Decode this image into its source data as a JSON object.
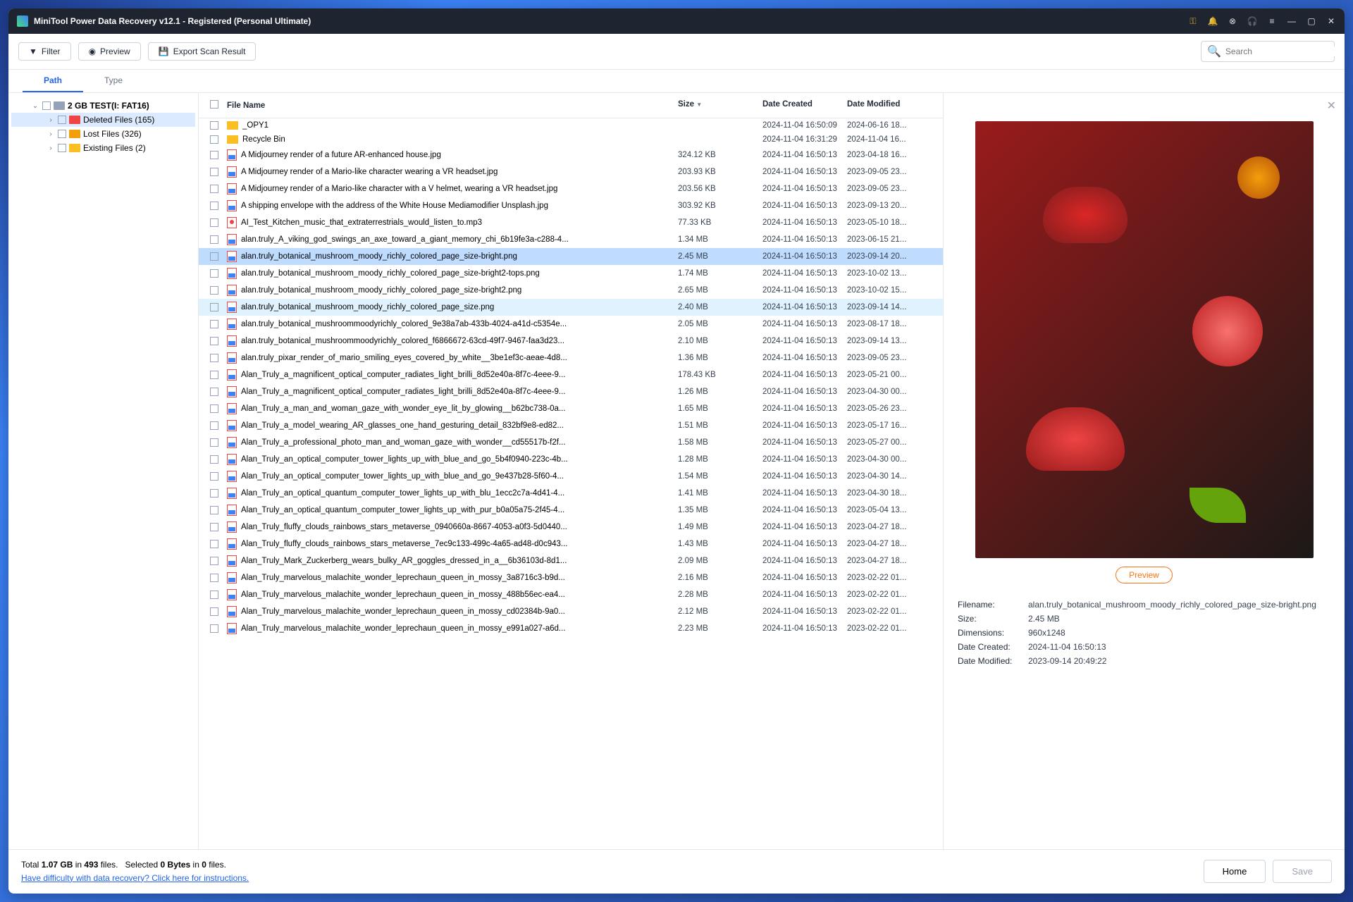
{
  "title": "MiniTool Power Data Recovery v12.1 - Registered (Personal Ultimate)",
  "toolbar": {
    "filter": "Filter",
    "preview": "Preview",
    "export": "Export Scan Result",
    "search_ph": "Search"
  },
  "tabs": {
    "path": "Path",
    "type": "Type"
  },
  "tree": {
    "root": "2 GB TEST(I: FAT16)",
    "deleted": "Deleted Files (165)",
    "lost": "Lost Files (326)",
    "existing": "Existing Files (2)"
  },
  "cols": {
    "name": "File Name",
    "size": "Size",
    "created": "Date Created",
    "modified": "Date Modified"
  },
  "files": [
    {
      "t": "folder",
      "n": "_OPY1",
      "s": "",
      "c": "2024-11-04 16:50:09",
      "m": "2024-06-16 18..."
    },
    {
      "t": "folder",
      "n": "Recycle Bin",
      "s": "",
      "c": "2024-11-04 16:31:29",
      "m": "2024-11-04 16..."
    },
    {
      "t": "img",
      "n": "A Midjourney render of a future AR-enhanced house.jpg",
      "s": "324.12 KB",
      "c": "2024-11-04 16:50:13",
      "m": "2023-04-18 16..."
    },
    {
      "t": "img",
      "n": "A Midjourney render of a Mario-like character wearing a VR headset.jpg",
      "s": "203.93 KB",
      "c": "2024-11-04 16:50:13",
      "m": "2023-09-05 23..."
    },
    {
      "t": "img",
      "n": "A Midjourney render of a Mario-like character with a V helmet, wearing a VR headset.jpg",
      "s": "203.56 KB",
      "c": "2024-11-04 16:50:13",
      "m": "2023-09-05 23..."
    },
    {
      "t": "img",
      "n": "A shipping envelope with the address of the White House Mediamodifier Unsplash.jpg",
      "s": "303.92 KB",
      "c": "2024-11-04 16:50:13",
      "m": "2023-09-13 20..."
    },
    {
      "t": "audio",
      "n": "AI_Test_Kitchen_music_that_extraterrestrials_would_listen_to.mp3",
      "s": "77.33 KB",
      "c": "2024-11-04 16:50:13",
      "m": "2023-05-10 18..."
    },
    {
      "t": "img",
      "n": "alan.truly_A_viking_god_swings_an_axe_toward_a_giant_memory_chi_6b19fe3a-c288-4...",
      "s": "1.34 MB",
      "c": "2024-11-04 16:50:13",
      "m": "2023-06-15 21..."
    },
    {
      "t": "img",
      "n": "alan.truly_botanical_mushroom_moody_richly_colored_page_size-bright.png",
      "s": "2.45 MB",
      "c": "2024-11-04 16:50:13",
      "m": "2023-09-14 20...",
      "sel": true
    },
    {
      "t": "img",
      "n": "alan.truly_botanical_mushroom_moody_richly_colored_page_size-bright2-tops.png",
      "s": "1.74 MB",
      "c": "2024-11-04 16:50:13",
      "m": "2023-10-02 13..."
    },
    {
      "t": "img",
      "n": "alan.truly_botanical_mushroom_moody_richly_colored_page_size-bright2.png",
      "s": "2.65 MB",
      "c": "2024-11-04 16:50:13",
      "m": "2023-10-02 15..."
    },
    {
      "t": "img",
      "n": "alan.truly_botanical_mushroom_moody_richly_colored_page_size.png",
      "s": "2.40 MB",
      "c": "2024-11-04 16:50:13",
      "m": "2023-09-14 14...",
      "hl": true
    },
    {
      "t": "img",
      "n": "alan.truly_botanical_mushroommoodyrichly_colored_9e38a7ab-433b-4024-a41d-c5354e...",
      "s": "2.05 MB",
      "c": "2024-11-04 16:50:13",
      "m": "2023-08-17 18..."
    },
    {
      "t": "img",
      "n": "alan.truly_botanical_mushroommoodyrichly_colored_f6866672-63cd-49f7-9467-faa3d23...",
      "s": "2.10 MB",
      "c": "2024-11-04 16:50:13",
      "m": "2023-09-14 13..."
    },
    {
      "t": "img",
      "n": "alan.truly_pixar_render_of_mario_smiling_eyes_covered_by_white__3be1ef3c-aeae-4d8...",
      "s": "1.36 MB",
      "c": "2024-11-04 16:50:13",
      "m": "2023-09-05 23..."
    },
    {
      "t": "img",
      "n": "Alan_Truly_a_magnificent_optical_computer_radiates_light_brilli_8d52e40a-8f7c-4eee-9...",
      "s": "178.43 KB",
      "c": "2024-11-04 16:50:13",
      "m": "2023-05-21 00..."
    },
    {
      "t": "img",
      "n": "Alan_Truly_a_magnificent_optical_computer_radiates_light_brilli_8d52e40a-8f7c-4eee-9...",
      "s": "1.26 MB",
      "c": "2024-11-04 16:50:13",
      "m": "2023-04-30 00..."
    },
    {
      "t": "img",
      "n": "Alan_Truly_a_man_and_woman_gaze_with_wonder_eye_lit_by_glowing__b62bc738-0a...",
      "s": "1.65 MB",
      "c": "2024-11-04 16:50:13",
      "m": "2023-05-26 23..."
    },
    {
      "t": "img",
      "n": "Alan_Truly_a_model_wearing_AR_glasses_one_hand_gesturing_detail_832bf9e8-ed82...",
      "s": "1.51 MB",
      "c": "2024-11-04 16:50:13",
      "m": "2023-05-17 16..."
    },
    {
      "t": "img",
      "n": "Alan_Truly_a_professional_photo_man_and_woman_gaze_with_wonder__cd55517b-f2f...",
      "s": "1.58 MB",
      "c": "2024-11-04 16:50:13",
      "m": "2023-05-27 00..."
    },
    {
      "t": "img",
      "n": "Alan_Truly_an_optical_computer_tower_lights_up_with_blue_and_go_5b4f0940-223c-4b...",
      "s": "1.28 MB",
      "c": "2024-11-04 16:50:13",
      "m": "2023-04-30 00..."
    },
    {
      "t": "img",
      "n": "Alan_Truly_an_optical_computer_tower_lights_up_with_blue_and_go_9e437b28-5f60-4...",
      "s": "1.54 MB",
      "c": "2024-11-04 16:50:13",
      "m": "2023-04-30 14..."
    },
    {
      "t": "img",
      "n": "Alan_Truly_an_optical_quantum_computer_tower_lights_up_with_blu_1ecc2c7a-4d41-4...",
      "s": "1.41 MB",
      "c": "2024-11-04 16:50:13",
      "m": "2023-04-30 18..."
    },
    {
      "t": "img",
      "n": "Alan_Truly_an_optical_quantum_computer_tower_lights_up_with_pur_b0a05a75-2f45-4...",
      "s": "1.35 MB",
      "c": "2024-11-04 16:50:13",
      "m": "2023-05-04 13..."
    },
    {
      "t": "img",
      "n": "Alan_Truly_fluffy_clouds_rainbows_stars_metaverse_0940660a-8667-4053-a0f3-5d0440...",
      "s": "1.49 MB",
      "c": "2024-11-04 16:50:13",
      "m": "2023-04-27 18..."
    },
    {
      "t": "img",
      "n": "Alan_Truly_fluffy_clouds_rainbows_stars_metaverse_7ec9c133-499c-4a65-ad48-d0c943...",
      "s": "1.43 MB",
      "c": "2024-11-04 16:50:13",
      "m": "2023-04-27 18..."
    },
    {
      "t": "img",
      "n": "Alan_Truly_Mark_Zuckerberg_wears_bulky_AR_goggles_dressed_in_a__6b36103d-8d1...",
      "s": "2.09 MB",
      "c": "2024-11-04 16:50:13",
      "m": "2023-04-27 18..."
    },
    {
      "t": "img",
      "n": "Alan_Truly_marvelous_malachite_wonder_leprechaun_queen_in_mossy_3a8716c3-b9d...",
      "s": "2.16 MB",
      "c": "2024-11-04 16:50:13",
      "m": "2023-02-22 01..."
    },
    {
      "t": "img",
      "n": "Alan_Truly_marvelous_malachite_wonder_leprechaun_queen_in_mossy_488b56ec-ea4...",
      "s": "2.28 MB",
      "c": "2024-11-04 16:50:13",
      "m": "2023-02-22 01..."
    },
    {
      "t": "img",
      "n": "Alan_Truly_marvelous_malachite_wonder_leprechaun_queen_in_mossy_cd02384b-9a0...",
      "s": "2.12 MB",
      "c": "2024-11-04 16:50:13",
      "m": "2023-02-22 01..."
    },
    {
      "t": "img",
      "n": "Alan_Truly_marvelous_malachite_wonder_leprechaun_queen_in_mossy_e991a027-a6d...",
      "s": "2.23 MB",
      "c": "2024-11-04 16:50:13",
      "m": "2023-02-22 01..."
    }
  ],
  "preview": {
    "btn": "Preview",
    "meta": {
      "filename_k": "Filename:",
      "filename_v": "alan.truly_botanical_mushroom_moody_richly_colored_page_size-bright.png",
      "size_k": "Size:",
      "size_v": "2.45 MB",
      "dim_k": "Dimensions:",
      "dim_v": "960x1248",
      "dc_k": "Date Created:",
      "dc_v": "2024-11-04 16:50:13",
      "dm_k": "Date Modified:",
      "dm_v": "2023-09-14 20:49:22"
    }
  },
  "status": {
    "total_pre": "Total ",
    "total_size": "1.07 GB",
    "total_in": " in ",
    "total_files": "493",
    "total_word": " files.",
    "sel_pre": "Selected ",
    "sel_bytes": "0 Bytes",
    "sel_in": " in ",
    "sel_files": "0",
    "sel_word": " files.",
    "help": "Have difficulty with data recovery? Click here for instructions.",
    "home": "Home",
    "save": "Save"
  }
}
